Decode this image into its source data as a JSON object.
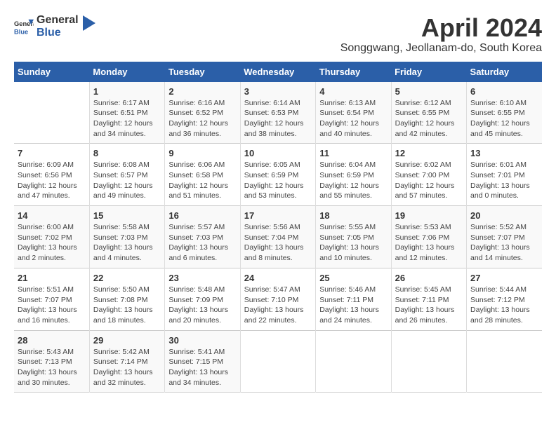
{
  "logo": {
    "general": "General",
    "blue": "Blue"
  },
  "title": "April 2024",
  "subtitle": "Songgwang, Jeollanam-do, South Korea",
  "weekdays": [
    "Sunday",
    "Monday",
    "Tuesday",
    "Wednesday",
    "Thursday",
    "Friday",
    "Saturday"
  ],
  "weeks": [
    [
      {
        "day": "",
        "info": ""
      },
      {
        "day": "1",
        "info": "Sunrise: 6:17 AM\nSunset: 6:51 PM\nDaylight: 12 hours\nand 34 minutes."
      },
      {
        "day": "2",
        "info": "Sunrise: 6:16 AM\nSunset: 6:52 PM\nDaylight: 12 hours\nand 36 minutes."
      },
      {
        "day": "3",
        "info": "Sunrise: 6:14 AM\nSunset: 6:53 PM\nDaylight: 12 hours\nand 38 minutes."
      },
      {
        "day": "4",
        "info": "Sunrise: 6:13 AM\nSunset: 6:54 PM\nDaylight: 12 hours\nand 40 minutes."
      },
      {
        "day": "5",
        "info": "Sunrise: 6:12 AM\nSunset: 6:55 PM\nDaylight: 12 hours\nand 42 minutes."
      },
      {
        "day": "6",
        "info": "Sunrise: 6:10 AM\nSunset: 6:55 PM\nDaylight: 12 hours\nand 45 minutes."
      }
    ],
    [
      {
        "day": "7",
        "info": "Sunrise: 6:09 AM\nSunset: 6:56 PM\nDaylight: 12 hours\nand 47 minutes."
      },
      {
        "day": "8",
        "info": "Sunrise: 6:08 AM\nSunset: 6:57 PM\nDaylight: 12 hours\nand 49 minutes."
      },
      {
        "day": "9",
        "info": "Sunrise: 6:06 AM\nSunset: 6:58 PM\nDaylight: 12 hours\nand 51 minutes."
      },
      {
        "day": "10",
        "info": "Sunrise: 6:05 AM\nSunset: 6:59 PM\nDaylight: 12 hours\nand 53 minutes."
      },
      {
        "day": "11",
        "info": "Sunrise: 6:04 AM\nSunset: 6:59 PM\nDaylight: 12 hours\nand 55 minutes."
      },
      {
        "day": "12",
        "info": "Sunrise: 6:02 AM\nSunset: 7:00 PM\nDaylight: 12 hours\nand 57 minutes."
      },
      {
        "day": "13",
        "info": "Sunrise: 6:01 AM\nSunset: 7:01 PM\nDaylight: 13 hours\nand 0 minutes."
      }
    ],
    [
      {
        "day": "14",
        "info": "Sunrise: 6:00 AM\nSunset: 7:02 PM\nDaylight: 13 hours\nand 2 minutes."
      },
      {
        "day": "15",
        "info": "Sunrise: 5:58 AM\nSunset: 7:03 PM\nDaylight: 13 hours\nand 4 minutes."
      },
      {
        "day": "16",
        "info": "Sunrise: 5:57 AM\nSunset: 7:03 PM\nDaylight: 13 hours\nand 6 minutes."
      },
      {
        "day": "17",
        "info": "Sunrise: 5:56 AM\nSunset: 7:04 PM\nDaylight: 13 hours\nand 8 minutes."
      },
      {
        "day": "18",
        "info": "Sunrise: 5:55 AM\nSunset: 7:05 PM\nDaylight: 13 hours\nand 10 minutes."
      },
      {
        "day": "19",
        "info": "Sunrise: 5:53 AM\nSunset: 7:06 PM\nDaylight: 13 hours\nand 12 minutes."
      },
      {
        "day": "20",
        "info": "Sunrise: 5:52 AM\nSunset: 7:07 PM\nDaylight: 13 hours\nand 14 minutes."
      }
    ],
    [
      {
        "day": "21",
        "info": "Sunrise: 5:51 AM\nSunset: 7:07 PM\nDaylight: 13 hours\nand 16 minutes."
      },
      {
        "day": "22",
        "info": "Sunrise: 5:50 AM\nSunset: 7:08 PM\nDaylight: 13 hours\nand 18 minutes."
      },
      {
        "day": "23",
        "info": "Sunrise: 5:48 AM\nSunset: 7:09 PM\nDaylight: 13 hours\nand 20 minutes."
      },
      {
        "day": "24",
        "info": "Sunrise: 5:47 AM\nSunset: 7:10 PM\nDaylight: 13 hours\nand 22 minutes."
      },
      {
        "day": "25",
        "info": "Sunrise: 5:46 AM\nSunset: 7:11 PM\nDaylight: 13 hours\nand 24 minutes."
      },
      {
        "day": "26",
        "info": "Sunrise: 5:45 AM\nSunset: 7:11 PM\nDaylight: 13 hours\nand 26 minutes."
      },
      {
        "day": "27",
        "info": "Sunrise: 5:44 AM\nSunset: 7:12 PM\nDaylight: 13 hours\nand 28 minutes."
      }
    ],
    [
      {
        "day": "28",
        "info": "Sunrise: 5:43 AM\nSunset: 7:13 PM\nDaylight: 13 hours\nand 30 minutes."
      },
      {
        "day": "29",
        "info": "Sunrise: 5:42 AM\nSunset: 7:14 PM\nDaylight: 13 hours\nand 32 minutes."
      },
      {
        "day": "30",
        "info": "Sunrise: 5:41 AM\nSunset: 7:15 PM\nDaylight: 13 hours\nand 34 minutes."
      },
      {
        "day": "",
        "info": ""
      },
      {
        "day": "",
        "info": ""
      },
      {
        "day": "",
        "info": ""
      },
      {
        "day": "",
        "info": ""
      }
    ]
  ]
}
